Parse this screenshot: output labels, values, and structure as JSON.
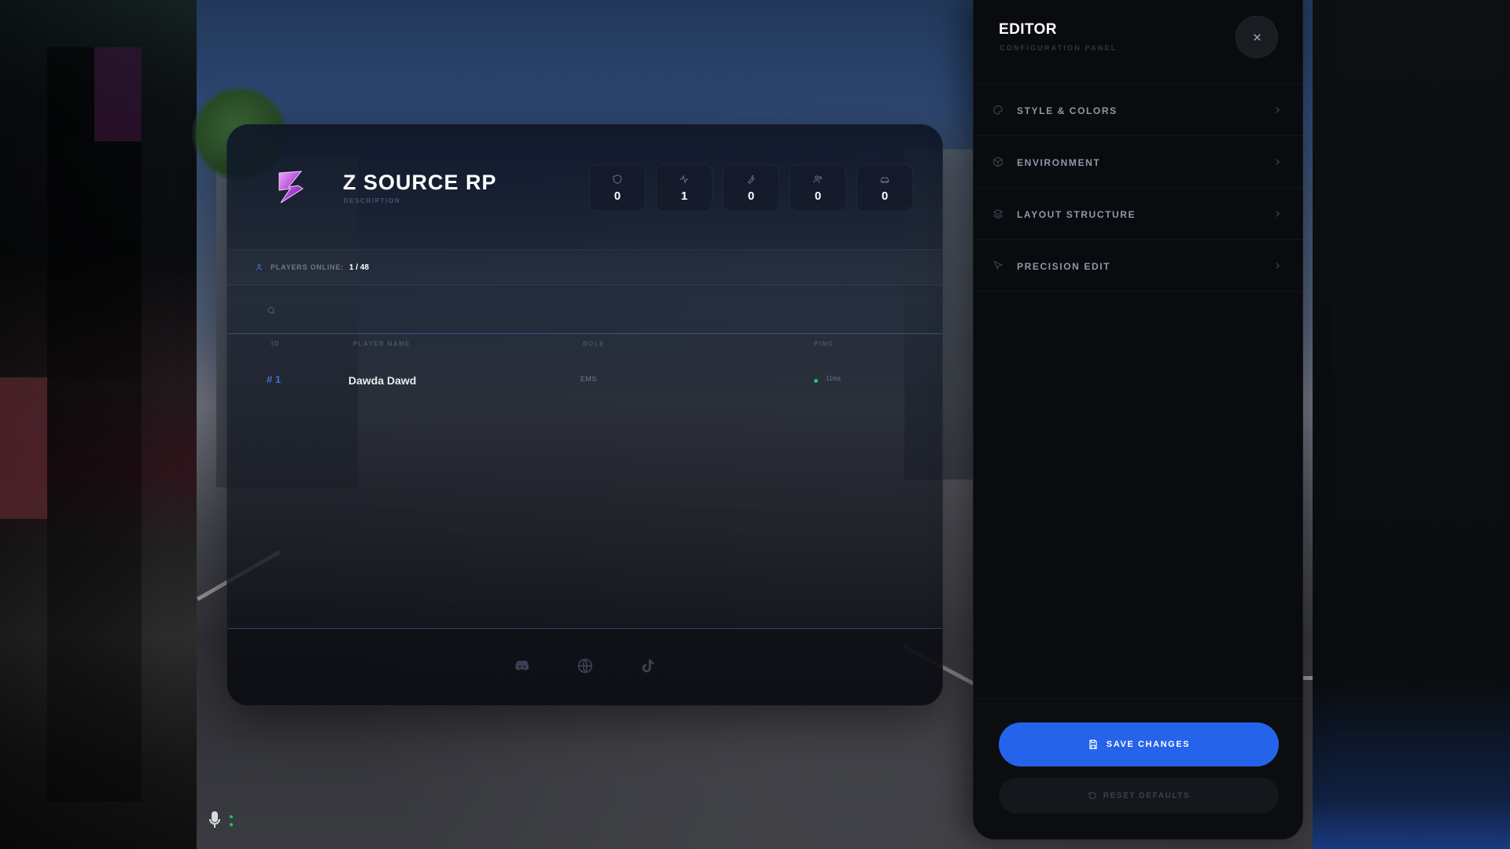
{
  "server": {
    "name": "Z SOURCE RP",
    "description": "DESCRIPTION",
    "logo_icon": "z-logo-icon",
    "accent_color": "#2563eb"
  },
  "stats": [
    {
      "icon": "shield-icon",
      "value": "0"
    },
    {
      "icon": "activity-icon",
      "value": "1"
    },
    {
      "icon": "wrench-icon",
      "value": "0"
    },
    {
      "icon": "users-icon",
      "value": "0"
    },
    {
      "icon": "car-icon",
      "value": "0"
    }
  ],
  "online": {
    "label": "PLAYERS ONLINE:",
    "count": "1 / 48"
  },
  "search": {
    "placeholder": ""
  },
  "table": {
    "headers": {
      "id": "ID",
      "name": "PLAYER NAME",
      "role": "ROLE",
      "ping": "PING"
    },
    "rows": [
      {
        "id": "# 1",
        "name": "Dawda Dawd",
        "role": "EMS",
        "ping": "11ms"
      }
    ]
  },
  "socials": [
    "discord-icon",
    "globe-icon",
    "tiktok-icon"
  ],
  "editor": {
    "title": "EDITOR",
    "subtitle": "CONFIGURATION PANEL",
    "menu": [
      {
        "label": "STYLE & COLORS",
        "icon": "palette-icon"
      },
      {
        "label": "ENVIRONMENT",
        "icon": "cube-icon"
      },
      {
        "label": "LAYOUT STRUCTURE",
        "icon": "layers-icon"
      },
      {
        "label": "PRECISION EDIT",
        "icon": "cursor-icon"
      }
    ],
    "save_label": "SAVE CHANGES",
    "reset_label": "RESET DEFAULTS"
  }
}
